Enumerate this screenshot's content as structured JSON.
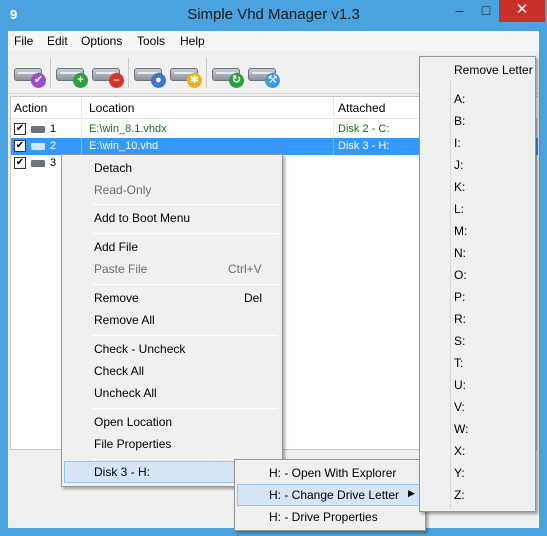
{
  "window": {
    "title": "Simple Vhd Manager v1.3",
    "app_icon_glyph": "9",
    "controls": {
      "minimize": "–",
      "maximize": "□",
      "close": "✕"
    }
  },
  "menubar": [
    "File",
    "Edit",
    "Options",
    "Tools",
    "Help"
  ],
  "toolbar": [
    {
      "name": "check-disk",
      "badge_color": "#9b4dcf",
      "badge_glyph": "✔"
    },
    {
      "name": "add-disk",
      "badge_color": "#2ea043",
      "badge_glyph": "+"
    },
    {
      "name": "remove-disk",
      "badge_color": "#d9342b",
      "badge_glyph": "–"
    },
    {
      "name": "search-disk",
      "badge_color": "#3d77c9",
      "badge_glyph": "●"
    },
    {
      "name": "settings-disk",
      "badge_color": "#e8b521",
      "badge_glyph": "✱"
    },
    {
      "name": "refresh-disk",
      "badge_color": "#2ea043",
      "badge_glyph": "↻"
    },
    {
      "name": "tools-disk",
      "badge_color": "#3d9ae8",
      "badge_glyph": "⚒"
    }
  ],
  "list": {
    "columns": [
      "Action",
      "Location",
      "Attached"
    ],
    "rows": [
      {
        "checked": "✔",
        "index": "1",
        "location": "E:\\win_8.1.vhdx",
        "attached": "Disk 2  -  C:",
        "selected": false
      },
      {
        "checked": "✔",
        "index": "2",
        "location": "E:\\win_10.vhd",
        "attached": "Disk 3  -  H:",
        "selected": true
      },
      {
        "checked": "✔",
        "index": "3",
        "location": "",
        "attached": "",
        "selected": false
      }
    ]
  },
  "context_menu": {
    "items": [
      {
        "label": "Detach",
        "enabled": true
      },
      {
        "label": "Read-Only",
        "enabled": false
      },
      {
        "label": "Add to Boot Menu",
        "enabled": true
      },
      {
        "label": "Add File",
        "enabled": true
      },
      {
        "label": "Paste File",
        "shortcut": "Ctrl+V",
        "enabled": false
      },
      {
        "label": "Remove",
        "shortcut": "Del",
        "enabled": true
      },
      {
        "label": "Remove All",
        "enabled": true
      },
      {
        "label": "Check - Uncheck",
        "enabled": true
      },
      {
        "label": "Check All",
        "enabled": true
      },
      {
        "label": "Uncheck All",
        "enabled": true
      },
      {
        "label": "Open Location",
        "enabled": true
      },
      {
        "label": "File Properties",
        "enabled": true
      },
      {
        "label": "Disk 3  -  H:",
        "enabled": true,
        "submenu": true
      }
    ]
  },
  "submenu": {
    "items": [
      {
        "label": "H: - Open With Explorer"
      },
      {
        "label": "H: - Change Drive Letter",
        "submenu": true
      },
      {
        "label": "H: - Drive Properties"
      }
    ]
  },
  "letters_menu": {
    "header": "Remove Letter",
    "letters": [
      "A:",
      "B:",
      "I:",
      "J:",
      "K:",
      "L:",
      "M:",
      "N:",
      "O:",
      "P:",
      "R:",
      "S:",
      "T:",
      "U:",
      "V:",
      "W:",
      "X:",
      "Y:",
      "Z:"
    ]
  },
  "glyphs": {
    "submenu_arrow": "▶"
  }
}
